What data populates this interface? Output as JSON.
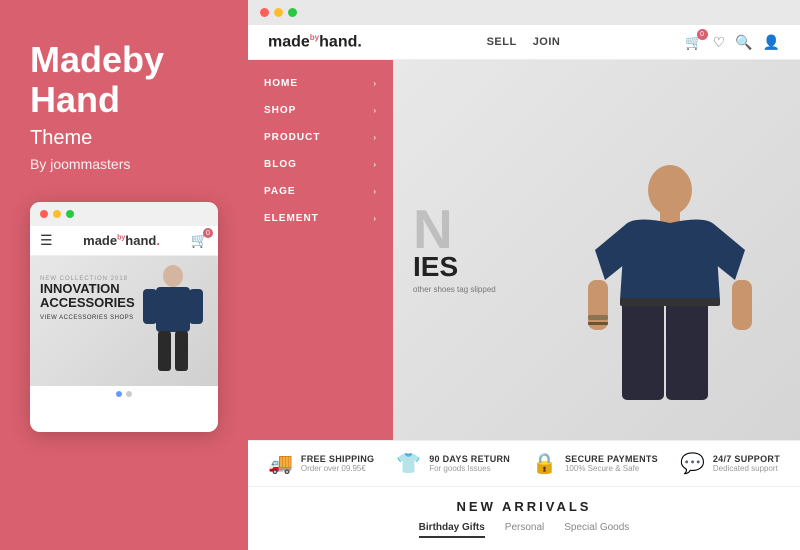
{
  "left": {
    "brand_name_line1": "Madeby",
    "brand_name_line2": "Hand",
    "theme_label": "Theme",
    "by_label": "By joommasters",
    "mobile_logo": "made",
    "mobile_logo_sup": "by",
    "mobile_logo_end": "hand.",
    "hero_label": "NEW COLLECTION 2018",
    "hero_title_line1": "INNOVATION",
    "hero_title_line2": "ACCESSORIES",
    "hero_link": "VIEW ACCESSORIES SHOPS"
  },
  "browser": {
    "dots": [
      "red",
      "yellow",
      "green"
    ]
  },
  "header": {
    "logo": "made",
    "logo_sup": "by",
    "logo_end": "hand.",
    "nav": [
      "SELL",
      "JOIN"
    ],
    "cart_count": "0"
  },
  "sidebar": {
    "items": [
      {
        "label": "HOME",
        "has_arrow": true
      },
      {
        "label": "SHOP",
        "has_arrow": true
      },
      {
        "label": "PRODUCT",
        "has_arrow": true
      },
      {
        "label": "BLOG",
        "has_arrow": true
      },
      {
        "label": "PAGE",
        "has_arrow": true
      },
      {
        "label": "ELEMENT",
        "has_arrow": true
      }
    ]
  },
  "hero": {
    "big_n": "N",
    "subtitle_line": "IES",
    "sub_text": "other shoes tag slipped"
  },
  "features": [
    {
      "icon": "🚚",
      "title": "Free Shipping",
      "desc": "Order over 09.95€"
    },
    {
      "icon": "👕",
      "title": "90 Days Return",
      "desc": "For goods Issues"
    },
    {
      "icon": "🔒",
      "title": "Secure Payments",
      "desc": "100% Secure & Safe"
    },
    {
      "icon": "💬",
      "title": "24/7 Support",
      "desc": "Dedicated support"
    }
  ],
  "new_arrivals": {
    "title": "NEW ARRIVALS",
    "tabs": [
      {
        "label": "Birthday Gifts",
        "active": true
      },
      {
        "label": "Personal",
        "active": false
      },
      {
        "label": "Special Goods",
        "active": false
      }
    ]
  }
}
